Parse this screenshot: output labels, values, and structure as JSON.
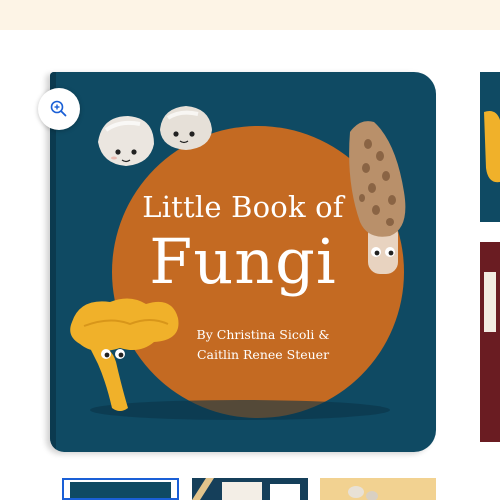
{
  "banner": {},
  "product_image": {
    "title_line1": "Little Book of",
    "title_line2": "Fungi",
    "author_line1": "By Christina Sicoli &",
    "author_line2": "Caitlin Renee Steuer",
    "colors": {
      "cover_background": "#0f4a63",
      "circle": "#c46a22",
      "chanterelle": "#f0b12a",
      "morel": "#b9906a",
      "button_mushroom": "#ebe6e0"
    }
  },
  "zoom": {
    "icon": "zoom-in-icon"
  },
  "thumbnails": [
    {
      "name": "thumbnail-1",
      "selected": true
    },
    {
      "name": "thumbnail-2",
      "selected": false
    },
    {
      "name": "thumbnail-3",
      "selected": false
    }
  ],
  "colors": {
    "banner": "#fdf4e6",
    "selected_thumbnail_border": "#1a5fd6"
  }
}
